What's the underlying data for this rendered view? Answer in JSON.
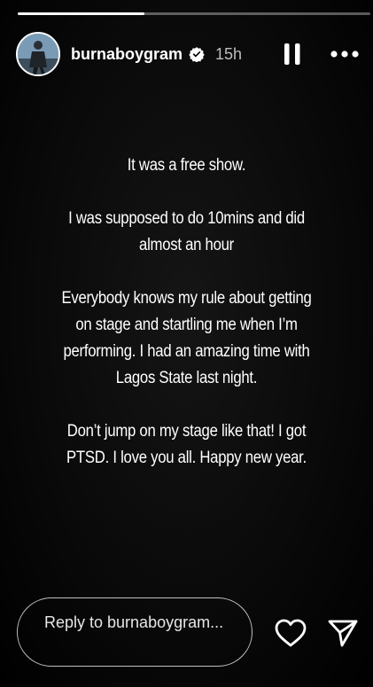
{
  "story": {
    "progress_fraction": 0.36,
    "accent_color": "#ffffff"
  },
  "header": {
    "username": "burnaboygram",
    "verified_icon": "verified-badge-icon",
    "timestamp": "15h",
    "pause_icon": "pause-icon",
    "more_icon": "more-icon"
  },
  "content": {
    "paragraphs": [
      "It was a free show.",
      "I was supposed to do 10mins and did almost an hour",
      "Everybody knows my rule about getting on stage and startling me when I’m performing. I had an amazing time with Lagos State last night.",
      "Don’t jump on my stage like that! I got PTSD.  I love you all. Happy new year."
    ]
  },
  "footer": {
    "reply_placeholder": "Reply to burnaboygram...",
    "like_icon": "heart-icon",
    "share_icon": "send-icon"
  }
}
